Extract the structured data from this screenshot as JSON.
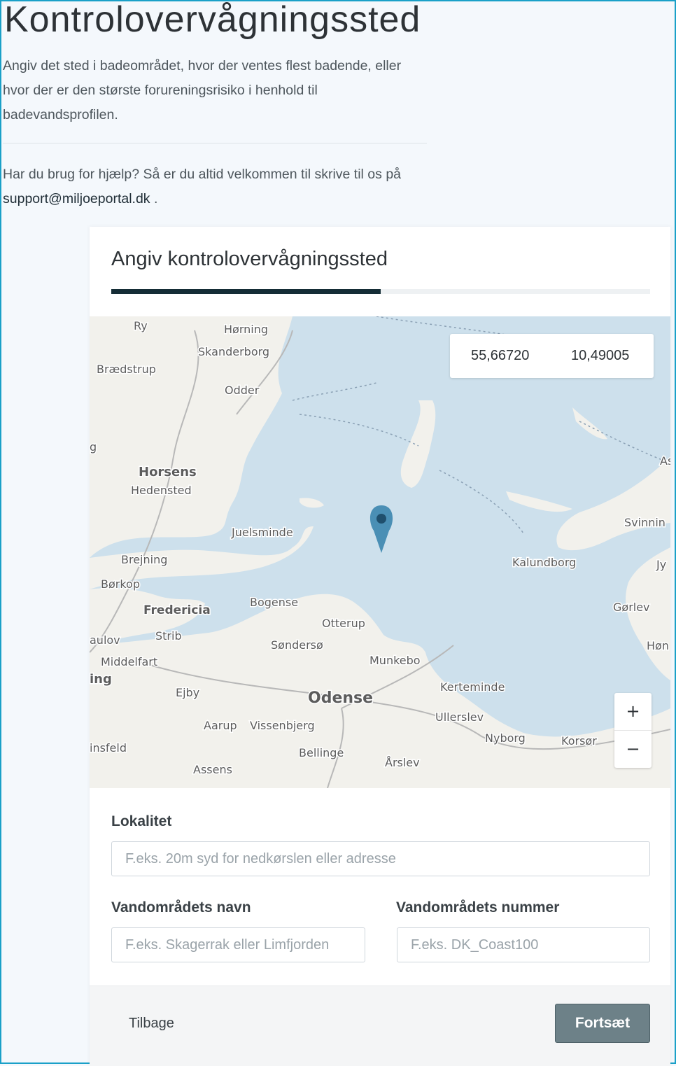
{
  "page": {
    "title": "Kontrolovervågningssted",
    "intro": "Angiv det sted i badeområdet, hvor der ventes flest badende, eller hvor der er den største forureningsrisiko i henhold til badevandsprofilen.",
    "help_prefix": "Har du brug for hjælp? Så er du altid velkommen til skrive til os på ",
    "help_email": "support@miljoeportal.dk",
    "help_suffix": " ."
  },
  "card": {
    "title": "Angiv kontrolovervågningssted",
    "progress_percent": 50
  },
  "map": {
    "latitude": "55,66720",
    "longitude": "10,49005",
    "zoom_in": "+",
    "zoom_out": "−",
    "places": {
      "ry": "Ry",
      "horning": "Hørning",
      "skanderborg": "Skanderborg",
      "braedstrup": "Brædstrup",
      "odder": "Odder",
      "g": "g",
      "horsens": "Horsens",
      "hedensted": "Hedensted",
      "juelsminde": "Juelsminde",
      "brejning": "Brejning",
      "borkop": "Børkop",
      "fredericia": "Fredericia",
      "bogense": "Bogense",
      "otterup": "Otterup",
      "aulov": "aulov",
      "strib": "Strib",
      "sonderso": "Søndersø",
      "munkebo": "Munkebo",
      "middelfart": "Middelfart",
      "ing": "ing",
      "ejby": "Ejby",
      "odense": "Odense",
      "kerteminde": "Kerteminde",
      "aarup": "Aarup",
      "vissenbjerg": "Vissenbjerg",
      "ullerslev": "Ullerslev",
      "nyborg": "Nyborg",
      "korsor": "Korsør",
      "insfeld": "insfeld",
      "bellinge": "Bellinge",
      "assens": "Assens",
      "arslev": "Årslev",
      "kalundborg": "Kalundborg",
      "svinning": "Svinnin",
      "gorlev": "Gørlev",
      "hon": "Høn",
      "jy": "Jy",
      "as": "As"
    }
  },
  "form": {
    "locality_label": "Lokalitet",
    "locality_placeholder": "F.eks. 20m syd for nedkørslen eller adresse",
    "water_name_label": "Vandområdets navn",
    "water_name_placeholder": "F.eks. Skagerrak eller Limfjorden",
    "water_number_label": "Vandområdets nummer",
    "water_number_placeholder": "F.eks. DK_Coast100"
  },
  "footer": {
    "back_label": "Tilbage",
    "continue_label": "Fortsæt"
  },
  "colors": {
    "progress_fill": "#152d36",
    "sea": "#cde0ec",
    "land": "#f2f1ec",
    "marker": "#4a8fb5",
    "continue_button": "#6d8188"
  }
}
